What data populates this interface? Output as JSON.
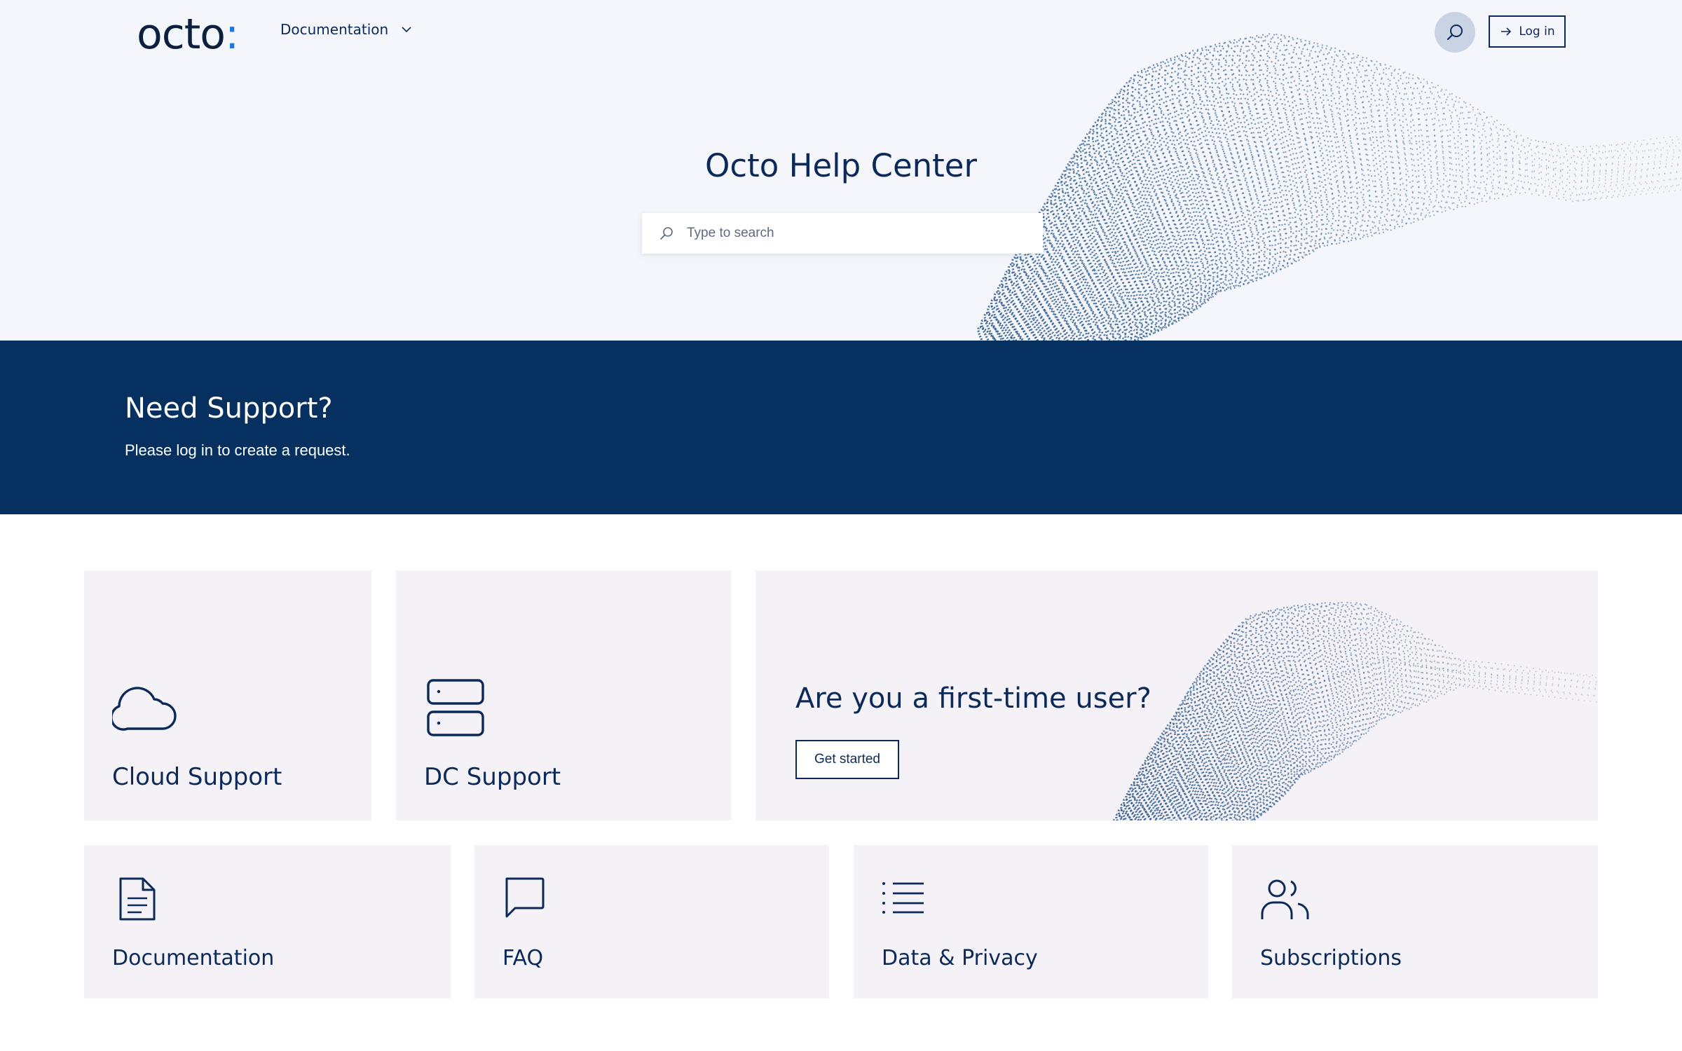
{
  "header": {
    "logo_text": "octo",
    "logo_dot": ":",
    "nav_documentation": "Documentation",
    "login_label": "Log in",
    "accent_color": "#1c78e6"
  },
  "hero": {
    "title": "Octo Help Center",
    "search_placeholder": "Type to search"
  },
  "support_band": {
    "title": "Need Support?",
    "subtitle": "Please log in to create a request.",
    "background_color": "#05305f"
  },
  "cards": {
    "cloud": {
      "label": "Cloud Support",
      "icon": "cloud-icon"
    },
    "dc": {
      "label": "DC Support",
      "icon": "server-icon"
    },
    "first_time": {
      "title": "Are you a first-time user?",
      "button_label": "Get started"
    },
    "documentation": {
      "label": "Documentation",
      "icon": "document-icon"
    },
    "faq": {
      "label": "FAQ",
      "icon": "chat-bubble-icon"
    },
    "data_privacy": {
      "label": "Data & Privacy",
      "icon": "list-icon"
    },
    "subscriptions": {
      "label": "Subscriptions",
      "icon": "users-icon"
    }
  }
}
